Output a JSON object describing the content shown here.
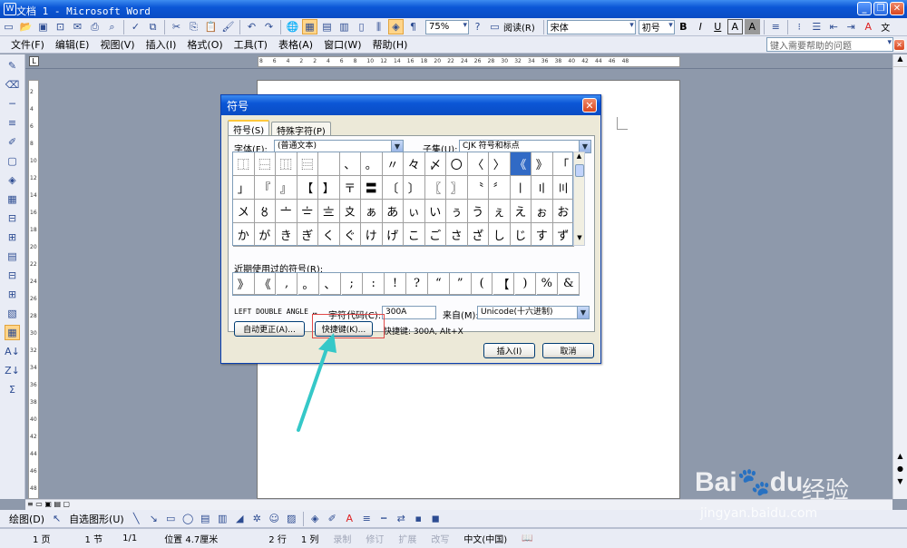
{
  "window": {
    "title": "文档 1 - Microsoft Word"
  },
  "menus": [
    "文件(F)",
    "编辑(E)",
    "视图(V)",
    "插入(I)",
    "格式(O)",
    "工具(T)",
    "表格(A)",
    "窗口(W)",
    "帮助(H)"
  ],
  "help_placeholder": "键入需要帮助的问题",
  "toolbar": {
    "zoom": "75%",
    "read_label": "阅读(R)",
    "font": "宋体",
    "size": "初号",
    "bold": "B",
    "italic": "I",
    "underline": "U",
    "a_label": "A",
    "font_color": "A",
    "wen": "文"
  },
  "ruler": {
    "h_ticks": [
      "8",
      "6",
      "4",
      "2",
      "2",
      "4",
      "6",
      "8",
      "10",
      "12",
      "14",
      "16",
      "18",
      "20",
      "22",
      "24",
      "26",
      "28",
      "30",
      "32",
      "34",
      "36",
      "38",
      "40",
      "42",
      "44",
      "46",
      "48"
    ],
    "v_ticks": [
      "2",
      "4",
      "6",
      "8",
      "10",
      "12",
      "14",
      "16",
      "18",
      "20",
      "22",
      "24",
      "26",
      "28",
      "30",
      "32",
      "34",
      "36",
      "38",
      "40",
      "42",
      "44",
      "46",
      "48"
    ],
    "h_ticks_bold": [
      "L"
    ]
  },
  "dialog": {
    "title": "符号",
    "tabs": [
      "符号(S)",
      "特殊字符(P)"
    ],
    "font_label": "字体(F):",
    "font_value": "(普通文本)",
    "subset_label": "子集(U):",
    "subset_value": "CJK 符号和标点",
    "symbols": [
      [
        "⿰",
        "⿱",
        "⿲",
        "⿳",
        "",
        "、",
        "。",
        "〃",
        "々",
        "〆",
        "〇",
        "〈",
        "〉",
        "《",
        "》",
        "「"
      ],
      [
        "」",
        "『",
        "』",
        "【",
        "】",
        "〒",
        "〓",
        "〔",
        "〕",
        "〖",
        "〗",
        "〝",
        "〞",
        "〡",
        "〢",
        "〣"
      ],
      [
        "〤",
        "〥",
        "〦",
        "〧",
        "〨",
        "〩",
        "ぁ",
        "あ",
        "ぃ",
        "い",
        "ぅ",
        "う",
        "ぇ",
        "え",
        "ぉ",
        "お"
      ],
      [
        "か",
        "が",
        "き",
        "ぎ",
        "く",
        "ぐ",
        "け",
        "げ",
        "こ",
        "ご",
        "さ",
        "ざ",
        "し",
        "じ",
        "す",
        "ず"
      ]
    ],
    "selected_index": 13,
    "recent_label": "近期使用过的符号(R):",
    "recent_symbols": [
      "》",
      "《",
      ",",
      "。",
      "、",
      ";",
      ":",
      "!",
      "?",
      "“",
      "”",
      "(",
      "【",
      ")",
      "%",
      "&"
    ],
    "char_name": "LEFT DOUBLE ANGLE …",
    "code_label": "字符代码(C):",
    "code_value": "300A",
    "from_label": "来自(M):",
    "from_value": "Unicode(十六进制)",
    "autocorrect_button": "自动更正(A)...",
    "shortcut_button": "快捷键(K)...",
    "shortcut_info": "快捷键: 300A, Alt+X",
    "insert_button": "插入(I)",
    "cancel_button": "取消"
  },
  "drawbar": {
    "draw": "绘图(D)",
    "autoshape": "自选图形(U)"
  },
  "status": {
    "page": "1 页",
    "section": "1 节",
    "pages": "1/1",
    "pos": "位置 4.7厘米",
    "line": "2 行",
    "col": "1 列",
    "rec": "录制",
    "trk": "修订",
    "ext": "扩展",
    "ovr": "改写",
    "lang": "中文(中国)"
  },
  "watermark": {
    "brand": "Bai",
    "brand2": "du",
    "cn": "经验",
    "url": "jingyan.baidu.com"
  },
  "colors": {
    "title_blue": "#0b56d6",
    "selection": "#316ac5",
    "highlight": "#e04848",
    "arrow": "#35c8c8"
  }
}
